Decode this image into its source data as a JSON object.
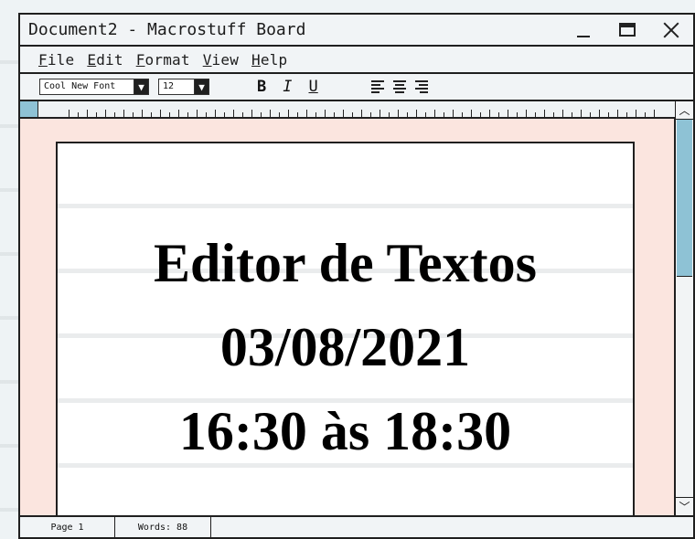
{
  "window": {
    "title": "Document2 - Macrostuff Board"
  },
  "menu": {
    "items": [
      "File",
      "Edit",
      "Format",
      "View",
      "Help"
    ]
  },
  "toolbar": {
    "font": "Cool New Font",
    "size": "12",
    "bold": "B",
    "italic": "I",
    "underline": "U"
  },
  "document": {
    "lines": [
      "Editor de Textos",
      "03/08/2021",
      "16:30 às 18:30"
    ]
  },
  "status": {
    "page": "Page 1",
    "words": "Words: 88"
  },
  "icons": {
    "window_controls": [
      "minimize-icon",
      "maximize-icon",
      "close-icon"
    ],
    "dropdowns": [
      "chevron-down-icon",
      "chevron-down-icon"
    ],
    "alignment": [
      "align-left-icon",
      "align-center-icon",
      "align-right-icon"
    ],
    "scroll": [
      "scroll-up-icon",
      "scroll-down-icon"
    ]
  },
  "colors": {
    "accent_blue": "#8ec2d5",
    "document_background": "#fbe5df",
    "paper": "#ffffff",
    "text": "#000000"
  }
}
